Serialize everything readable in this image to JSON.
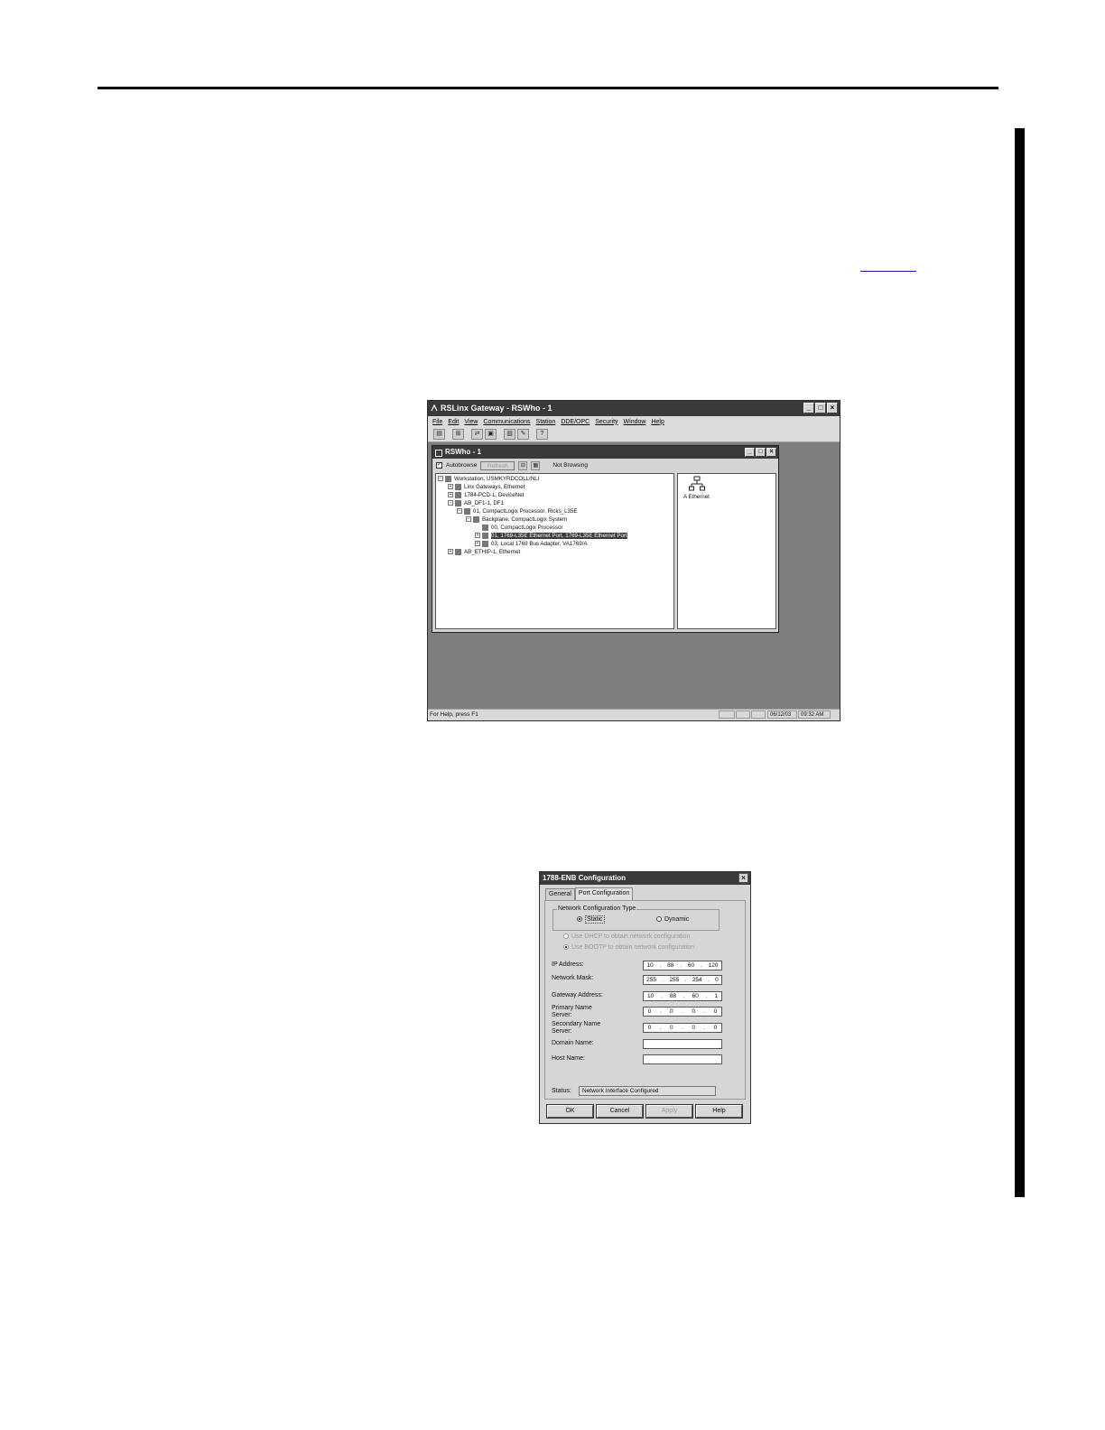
{
  "rslinx": {
    "title": "RSLinx Gateway - RSWho - 1",
    "menu": [
      "File",
      "Edit",
      "View",
      "Communications",
      "Station",
      "DDE/OPC",
      "Security",
      "Window",
      "Help"
    ],
    "status_help": "For Help, press F1",
    "status_date": "06/12/03",
    "status_time": "09:32 AM",
    "rswho": {
      "title": "RSWho - 1",
      "autobrowse_label": "Autobrowse",
      "refresh_label": "Refresh",
      "browse_status": "Not Browsing",
      "tree": [
        {
          "text": "Workstation, USMKYRDCOLLINLI",
          "exp": "-"
        },
        {
          "text": "Linx Gateways, Ethernet",
          "exp": "+"
        },
        {
          "text": "1784-PCD-1, DeviceNet",
          "exp": "+"
        },
        {
          "text": "AB_DF1-1, DF1",
          "exp": "-"
        },
        {
          "text": "01, CompactLogix Processor, Ricks_L35E",
          "exp": "-"
        },
        {
          "text": "Backplane, CompactLogix System",
          "exp": "-"
        },
        {
          "text": "00, CompactLogix Processor",
          "exp": ""
        },
        {
          "text": "01, 1769-L35E Ethernet Port, 1769-L35E Ethernet Port",
          "exp": "+"
        },
        {
          "text": "03, Local 1769 Bus Adapter, VA1769/A",
          "exp": "+"
        },
        {
          "text": "AB_ETHIP-1, Ethernet",
          "exp": "+"
        }
      ],
      "detail_item": "A Ethernet"
    }
  },
  "enb_dialog": {
    "title": "1788-ENB Configuration",
    "tabs": [
      "General",
      "Port Configuration"
    ],
    "group_title": "Network Configuration Type",
    "radio_static": "Static",
    "radio_dynamic": "Dynamic",
    "opt_dhcp": "Use DHCP to obtain network configuration",
    "opt_bootp": "Use BOOTP to obtain network configuration",
    "fields": {
      "ip_label": "IP Address:",
      "ip": [
        "10",
        "88",
        "60",
        "120"
      ],
      "mask_label": "Network Mask:",
      "mask": [
        "255",
        "255",
        "254",
        "0"
      ],
      "gateway_label": "Gateway Address:",
      "gateway": [
        "10",
        "88",
        "60",
        "1"
      ],
      "primary_label_1": "Primary Name",
      "primary_label_2": "Server:",
      "primary": [
        "0",
        "0",
        "0",
        "0"
      ],
      "secondary_label_1": "Secondary Name",
      "secondary_label_2": "Server:",
      "secondary": [
        "0",
        "0",
        "0",
        "0"
      ],
      "domain_label": "Domain Name:",
      "host_label": "Host Name:"
    },
    "status_label": "Status:",
    "status_value": "Network Interface Configured",
    "buttons": {
      "ok": "OK",
      "cancel": "Cancel",
      "apply": "Apply",
      "help": "Help"
    }
  }
}
